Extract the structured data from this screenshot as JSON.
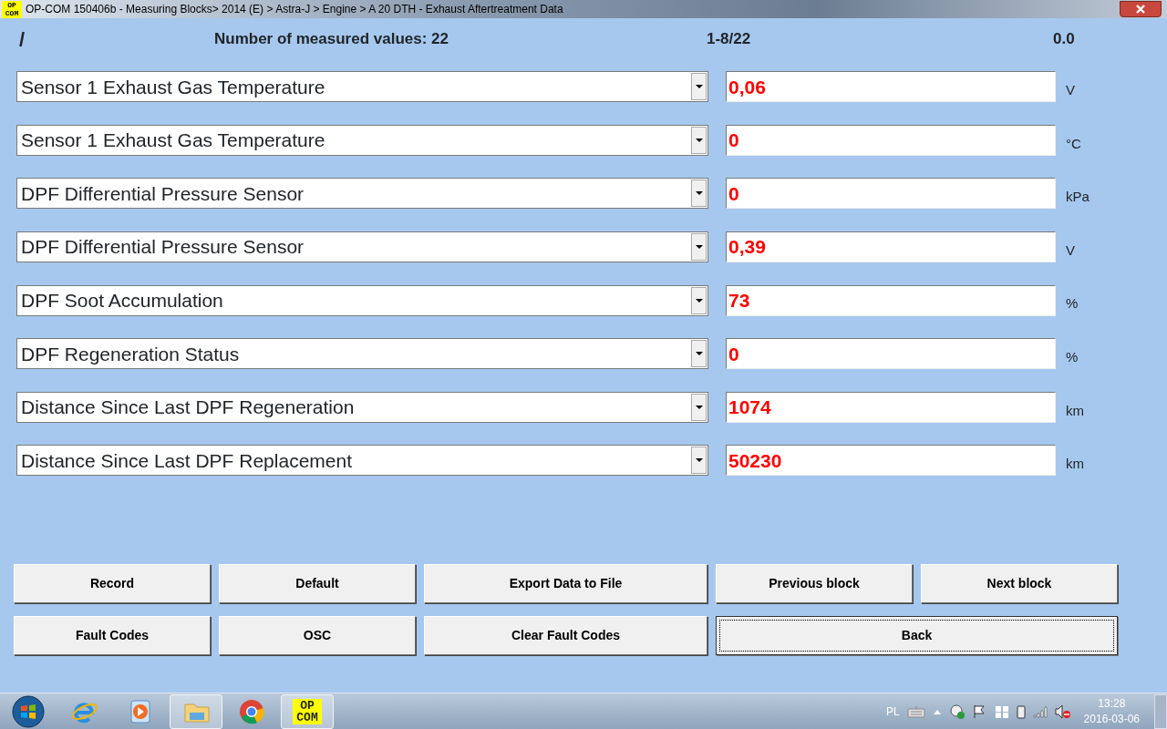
{
  "window": {
    "logo": [
      "OP",
      "COM"
    ],
    "title": "OP-COM 150406b - Measuring Blocks> 2014 (E) > Astra-J > Engine > A 20 DTH - Exhaust Aftertreatment Data"
  },
  "header": {
    "indicator": "/",
    "count": "Number of measured values: 22",
    "range": "1-8/22",
    "value": "0.0"
  },
  "measurements": [
    {
      "name": "Sensor 1 Exhaust Gas Temperature",
      "value": "0,06",
      "unit": "V"
    },
    {
      "name": "Sensor 1 Exhaust Gas Temperature",
      "value": "0",
      "unit": "°C"
    },
    {
      "name": "DPF Differential Pressure Sensor",
      "value": "0",
      "unit": "kPa"
    },
    {
      "name": "DPF Differential Pressure Sensor",
      "value": "0,39",
      "unit": "V"
    },
    {
      "name": "DPF Soot Accumulation",
      "value": "73",
      "unit": "%"
    },
    {
      "name": "DPF Regeneration Status",
      "value": "0",
      "unit": "%"
    },
    {
      "name": "Distance Since Last DPF Regeneration",
      "value": "1074",
      "unit": "km"
    },
    {
      "name": "Distance Since Last DPF Replacement",
      "value": "50230",
      "unit": "km"
    }
  ],
  "button_rows": [
    [
      {
        "label": "Record",
        "focused": false
      },
      {
        "label": "Default",
        "focused": false
      },
      {
        "label": "Export Data to File",
        "focused": false
      },
      {
        "label": "Previous block",
        "focused": false
      },
      {
        "label": "Next block",
        "focused": false
      }
    ],
    [
      {
        "label": "Fault Codes",
        "focused": false
      },
      {
        "label": "OSC",
        "focused": false
      },
      {
        "label": "Clear Fault Codes",
        "focused": false
      },
      {
        "label": "Back",
        "focused": true
      }
    ]
  ],
  "taskbar": {
    "apps": [
      {
        "kind": "browser-e",
        "running": false
      },
      {
        "kind": "media",
        "running": false
      },
      {
        "kind": "folder",
        "running": true
      },
      {
        "kind": "chrome",
        "running": false
      },
      {
        "kind": "opcom",
        "running": true,
        "label": [
          "OP",
          "COM"
        ]
      }
    ],
    "tray": {
      "language": "PL",
      "time": "13:28",
      "date": "2016-03-06"
    }
  }
}
